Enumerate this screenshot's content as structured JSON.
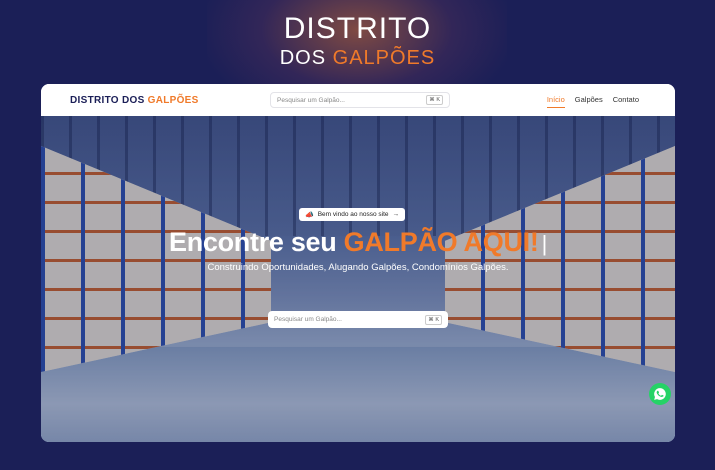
{
  "brand": {
    "line1": "DISTRITO",
    "line2_a": "DOS ",
    "line2_b": "GALPÕES"
  },
  "nav": {
    "logo_a": "DISTRITO DOS ",
    "logo_b": "GALPÕES",
    "search_placeholder": "Pesquisar um Galpão...",
    "search_shortcut": "⌘ K",
    "links": [
      {
        "label": "Início",
        "active": true
      },
      {
        "label": "Galpões",
        "active": false
      },
      {
        "label": "Contato",
        "active": false
      }
    ]
  },
  "hero": {
    "badge_icon": "megaphone-icon",
    "badge_text": "Bem vindo ao nosso site",
    "badge_arrow": "→",
    "headline_a": "Encontre seu ",
    "headline_b": "GALPÃO AQUI!",
    "cursor": "|",
    "subline": "Construindo Oportunidades, Alugando Galpões, Condomínios Galpões.",
    "search_placeholder": "Pesquisar um Galpão...",
    "search_shortcut": "⌘ K"
  },
  "whatsapp": {
    "icon": "whatsapp-icon"
  },
  "colors": {
    "accent": "#f07a2a",
    "navy": "#1b1f57",
    "whatsapp": "#25d366"
  }
}
